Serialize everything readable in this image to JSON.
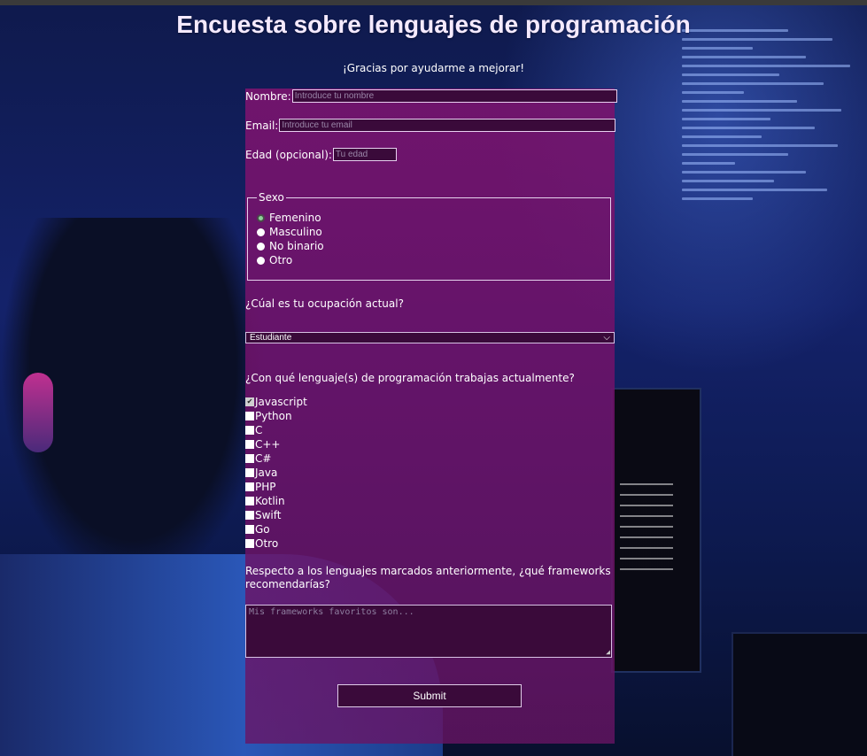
{
  "page": {
    "title": "Encuesta sobre lenguajes de programación",
    "subtitle": "¡Gracias por ayudarme a mejorar!"
  },
  "fields": {
    "name": {
      "label": "Nombre:",
      "placeholder": "Introduce tu nombre",
      "value": ""
    },
    "email": {
      "label": "Email:",
      "placeholder": "Introduce tu email",
      "value": ""
    },
    "age": {
      "label": "Edad (opcional):",
      "placeholder": "Tu edad",
      "value": ""
    }
  },
  "gender": {
    "legend": "Sexo",
    "options": [
      "Femenino",
      "Masculino",
      "No binario",
      "Otro"
    ],
    "selected": "Femenino"
  },
  "occupation": {
    "question": "¿Cúal es tu ocupación actual?",
    "selected": "Estudiante"
  },
  "languages": {
    "question": "¿Con qué lenguaje(s) de programación trabajas actualmente?",
    "options": [
      {
        "label": "Javascript",
        "checked": true
      },
      {
        "label": "Python",
        "checked": false
      },
      {
        "label": "C",
        "checked": false
      },
      {
        "label": "C++",
        "checked": false
      },
      {
        "label": "C#",
        "checked": false
      },
      {
        "label": "Java",
        "checked": false
      },
      {
        "label": "PHP",
        "checked": false
      },
      {
        "label": "Kotlin",
        "checked": false
      },
      {
        "label": "Swift",
        "checked": false
      },
      {
        "label": "Go",
        "checked": false
      },
      {
        "label": "Otro",
        "checked": false
      }
    ]
  },
  "frameworks": {
    "question": "Respecto a los lenguajes marcados anteriormente, ¿qué frameworks recomendarías?",
    "placeholder": "Mis frameworks favoritos son..."
  },
  "submit_label": "Submit",
  "colors": {
    "panel": "#781470",
    "input_bg": "#3a0a3a",
    "title": "#f5eaff"
  }
}
